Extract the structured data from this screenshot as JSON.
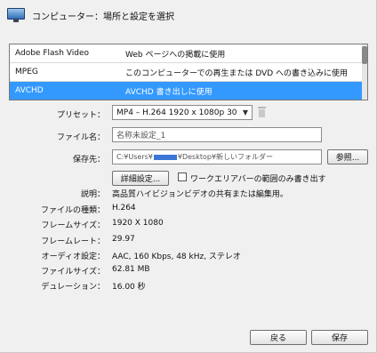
{
  "header": {
    "title": "コンピューター：場所と設定を選択",
    "icon": "monitor-icon"
  },
  "formats": [
    {
      "name": "Adobe Flash Video",
      "desc": "Web ページへの掲載に使用",
      "selected": false
    },
    {
      "name": "MPEG",
      "desc": "このコンピューターでの再生または DVD への書き込みに使用",
      "selected": false
    },
    {
      "name": "AVCHD",
      "desc": "AVCHD 書き出しに使用",
      "selected": true
    }
  ],
  "preset": {
    "label": "プリセット：",
    "value": "MP4 – H.264 1920 x 1080p 30"
  },
  "filename": {
    "label": "ファイル名：",
    "value": "名称未設定_1"
  },
  "saveto": {
    "label": "保存先：",
    "value_prefix": "C:¥Users¥",
    "value_suffix": "¥Desktop¥新しいフォルダー",
    "browse_label": "参照..."
  },
  "advanced_label": "詳細設定...",
  "workarea_checkbox": {
    "label": "ワークエリアバーの範囲のみ書き出す",
    "checked": false
  },
  "info": {
    "description_label": "説明：",
    "description": "高品質ハイビジョンビデオの共有または編集用。",
    "filetype_label": "ファイルの種類：",
    "filetype": "H.264",
    "framesize_label": "フレームサイズ：",
    "framesize": "1920 X 1080",
    "framerate_label": "フレームレート：",
    "framerate": "29.97",
    "audio_label": "オーディオ設定：",
    "audio": "AAC, 160 Kbps, 48 kHz, ステレオ",
    "filesize_label": "ファイルサイズ：",
    "filesize": "62.81 MB",
    "duration_label": "デュレーション：",
    "duration": "16.00 秒"
  },
  "buttons": {
    "back": "戻る",
    "save": "保存"
  }
}
